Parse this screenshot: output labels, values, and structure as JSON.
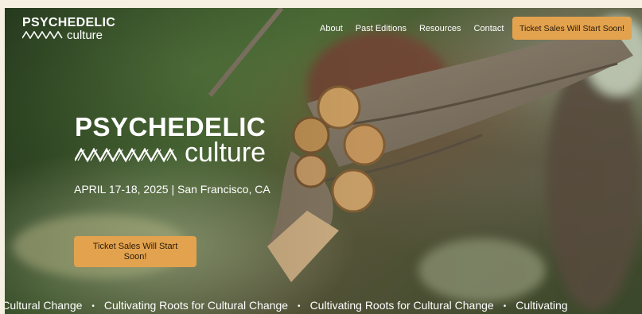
{
  "brand": {
    "logo_line1": "PSYCHEDELIC",
    "logo_line2": "culture"
  },
  "nav": {
    "items": [
      {
        "label": "About"
      },
      {
        "label": "Past Editions"
      },
      {
        "label": "Resources"
      },
      {
        "label": "Contact"
      }
    ],
    "cta_label": "Ticket Sales Will Start Soon!"
  },
  "hero": {
    "logo_line1": "PSYCHEDELIC",
    "logo_line2": "culture",
    "date": "APRIL 17-18, 2025 | San Francisco, CA",
    "cta_label": "Ticket Sales Will Start Soon!"
  },
  "marquee": {
    "segments": [
      "for Cultural Change",
      "Cultivating Roots for Cultural Change",
      "Cultivating Roots for Cultural Change",
      "Cultivating"
    ],
    "separator": "•"
  },
  "colors": {
    "accent": "#e3a24e",
    "page_background": "#f5f0e1",
    "text_on_image": "#ffffff"
  }
}
